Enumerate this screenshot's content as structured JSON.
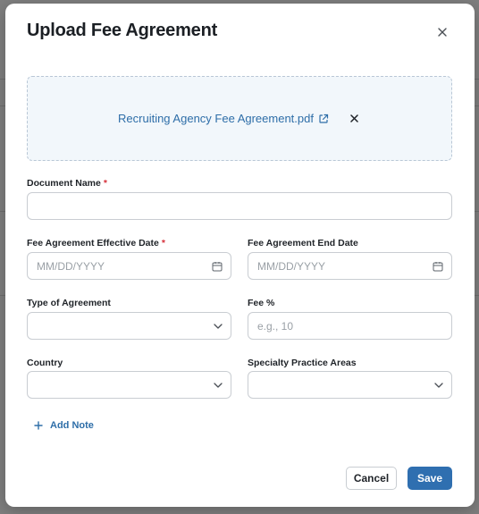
{
  "modal": {
    "title": "Upload Fee Agreement",
    "close_icon": "close-icon"
  },
  "upload": {
    "file_name": "Recruiting Agency Fee Agreement.pdf",
    "open_icon": "external-link-icon",
    "remove_icon": "close-icon"
  },
  "form": {
    "document_name": {
      "label": "Document Name",
      "required_mark": "*",
      "value": ""
    },
    "effective_date": {
      "label": "Fee Agreement Effective Date",
      "required_mark": "*",
      "placeholder": "MM/DD/YYYY"
    },
    "end_date": {
      "label": "Fee Agreement End Date",
      "placeholder": "MM/DD/YYYY"
    },
    "type_of_agreement": {
      "label": "Type of Agreement",
      "value": ""
    },
    "fee_percent": {
      "label": "Fee %",
      "placeholder": "e.g., 10"
    },
    "country": {
      "label": "Country",
      "value": ""
    },
    "specialty_practice_areas": {
      "label": "Specialty Practice Areas",
      "value": ""
    }
  },
  "add_note": {
    "label": "Add Note",
    "icon": "plus-icon"
  },
  "actions": {
    "cancel_label": "Cancel",
    "save_label": "Save"
  },
  "colors": {
    "accent": "#2f6fb0",
    "link": "#2e6ea8",
    "required": "#d6303a"
  }
}
